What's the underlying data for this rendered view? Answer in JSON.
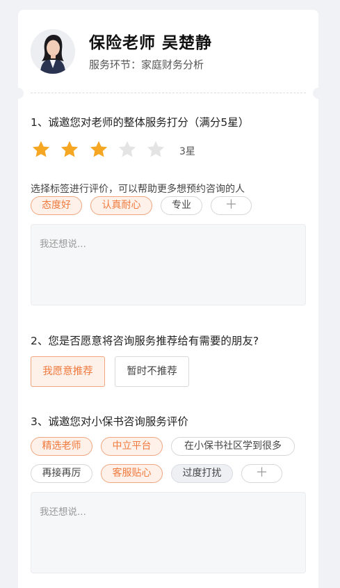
{
  "header": {
    "name": "保险老师 吴楚静",
    "stage": "服务环节：家庭财务分析"
  },
  "q1": {
    "title": "1、诚邀您对老师的整体服务打分（满分5星）",
    "rating": 3,
    "max_rating": 5,
    "rating_text": "3星",
    "hint": "选择标签进行评价，可以帮助更多想预约咨询的人",
    "tags": [
      {
        "label": "态度好",
        "selected": true
      },
      {
        "label": "认真耐心",
        "selected": true
      },
      {
        "label": "专业",
        "selected": false
      },
      {
        "label": "＋",
        "selected": false
      }
    ],
    "placeholder": "我还想说..."
  },
  "q2": {
    "title": "2、您是否愿意将咨询服务推荐给有需要的朋友?",
    "options": [
      {
        "label": "我愿意推荐",
        "selected": true
      },
      {
        "label": "暂时不推荐",
        "selected": false
      }
    ]
  },
  "q3": {
    "title": "3、诚邀您对小保书咨询服务评价",
    "tags": [
      {
        "label": "精选老师",
        "selected": true
      },
      {
        "label": "中立平台",
        "selected": true
      },
      {
        "label": "在小保书社区学到很多",
        "selected": false
      },
      {
        "label": "再接再厉",
        "selected": false
      },
      {
        "label": "客服贴心",
        "selected": true
      },
      {
        "label": "过度打扰",
        "selected": false
      },
      {
        "label": "＋",
        "selected": false
      }
    ],
    "placeholder": "我还想说..."
  },
  "colors": {
    "accent": "#f07a3e",
    "accent_bg": "#fdf1ea",
    "star_on": "#f5a623",
    "star_off": "#e4e4e4",
    "page_bg": "#f1f2f5"
  }
}
